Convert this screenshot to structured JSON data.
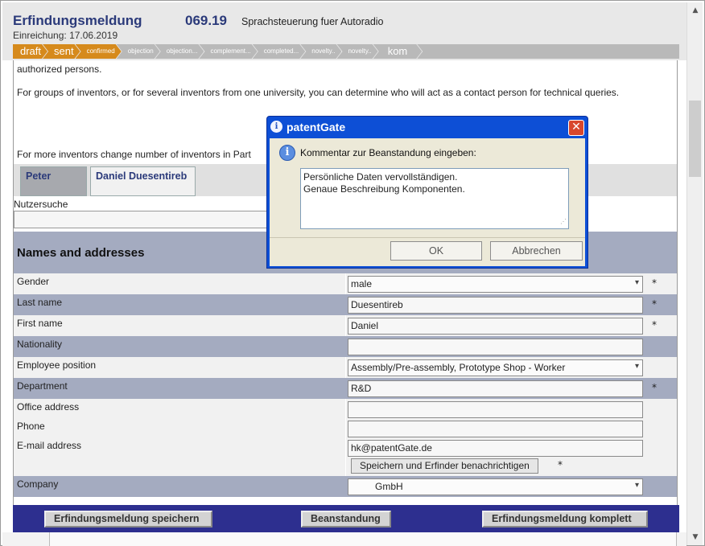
{
  "header": {
    "title": "Erfindungsmeldung",
    "number": "069.19",
    "description": "Sprachsteuerung fuer Autoradio",
    "submission_label": "Einreichung:",
    "submission_date": "17.06.2019"
  },
  "steps": [
    {
      "label": "draft"
    },
    {
      "label": "sent"
    },
    {
      "label": "confirmed"
    },
    {
      "label": "objection"
    },
    {
      "label": "objection..."
    },
    {
      "label": "complement..."
    },
    {
      "label": "completed..."
    },
    {
      "label": "novelty.."
    },
    {
      "label": "novelty.."
    },
    {
      "label": "kom"
    }
  ],
  "content": {
    "para1": "authorized persons.",
    "para2": "For groups of inventors, or for several inventors from one university, you can determine who will act as a contact person for technical queries.",
    "para3": "For more inventors change number of inventors in Part"
  },
  "tabs": [
    {
      "label": "Peter"
    },
    {
      "label": "Daniel Duesentireb"
    }
  ],
  "search": {
    "label": "Nutzersuche",
    "value": ""
  },
  "section": {
    "title": "Names and addresses"
  },
  "form": {
    "gender": {
      "label": "Gender",
      "value": "male",
      "required": "*"
    },
    "last_name": {
      "label": "Last name",
      "value": "Duesentireb",
      "required": "*"
    },
    "first_name": {
      "label": "First name",
      "value": "Daniel",
      "required": "*"
    },
    "nationality": {
      "label": "Nationality",
      "value": ""
    },
    "employee_position": {
      "label": "Employee position",
      "value": "Assembly/Pre-assembly, Prototype Shop - Worker"
    },
    "department": {
      "label": "Department",
      "value": "R&D",
      "required": "*"
    },
    "office_address": {
      "label": "Office address",
      "value": ""
    },
    "phone": {
      "label": "Phone",
      "value": ""
    },
    "email": {
      "label": "E-mail address",
      "value": "hk@patentGate.de"
    },
    "save_notify_label": "Speichern und Erfinder benachrichtigen",
    "save_notify_required": "*",
    "company": {
      "label": "Company",
      "value": "GmbH"
    }
  },
  "footer": {
    "save_label": "Erfindungsmeldung speichern",
    "objection_label": "Beanstandung",
    "complete_label": "Erfindungsmeldung komplett"
  },
  "dialog": {
    "title": "patentGate",
    "prompt": "Kommentar zur Beanstandung eingeben:",
    "comment_line1": "Persönliche Daten vervollständigen.",
    "comment_line2": "Genaue Beschreibung Komponenten.",
    "ok_label": "OK",
    "cancel_label": "Abbrechen",
    "close_glyph": "✕"
  },
  "colors": {
    "accent_navy": "#2b3a7a",
    "step_done": "#d68a1c",
    "step_pending": "#b9b9b9",
    "section_band": "#a4abc0",
    "footer": "#2d2f8f",
    "dialog_frame": "#0d4fd6"
  }
}
